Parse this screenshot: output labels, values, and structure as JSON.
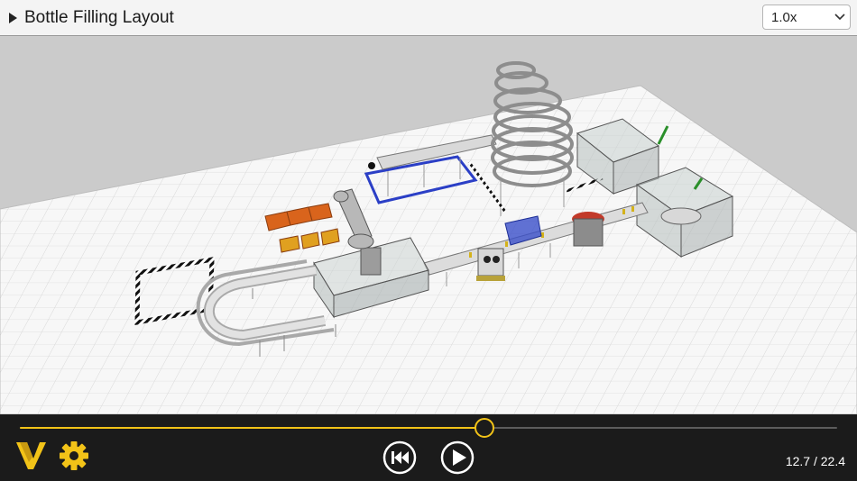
{
  "header": {
    "title": "Bottle Filling Layout",
    "speed": "1.0x"
  },
  "playback": {
    "progress": 0.567,
    "time": "12.7 / 22.4"
  },
  "icons": {
    "logo": "v-logo-icon",
    "settings": "gear-icon",
    "rewind": "skip-back-icon",
    "play": "play-icon"
  },
  "colors": {
    "accent": "#f2c318",
    "controls_bg": "#1b1b1b",
    "header_bg": "#f4f4f4",
    "viewport_bg": "#cbcbcb"
  }
}
